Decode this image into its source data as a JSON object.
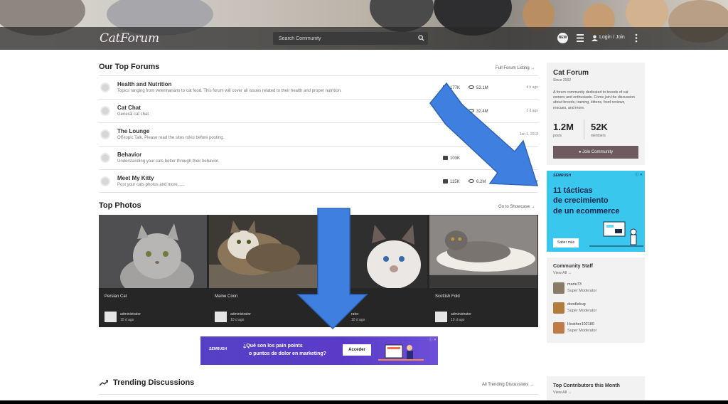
{
  "header": {
    "logo": "CatForum",
    "search_placeholder": "Search Community",
    "new_label": "NEW",
    "login_label": "Login / Join"
  },
  "top_forums": {
    "title": "Our Top Forums",
    "link": "Full Forum Listing →",
    "rows": [
      {
        "name": "Health and Nutrition",
        "desc": "Topics ranging from veterinarians to cat food. This forum will cover all issues related to their health and proper nutrition.",
        "threads": "177K",
        "views": "53.1M",
        "age": "4 h ago"
      },
      {
        "name": "Cat Chat",
        "desc": "General cat chat.",
        "threads": "K",
        "views": "32.4M",
        "age": "1 d ago"
      },
      {
        "name": "The Lounge",
        "desc": "Off-topic Talk. Please read the sites rules before posting.",
        "threads": "",
        "views": "",
        "age": "Jan 1, 2018"
      },
      {
        "name": "Behavior",
        "desc": "Understanding your cats better through their behavior.",
        "threads": "103K",
        "views": "",
        "age": ""
      },
      {
        "name": "Meet My Kitty",
        "desc": "Post your cats photos and more......",
        "threads": "115K",
        "views": "6.2M",
        "age": "ago"
      }
    ]
  },
  "top_photos": {
    "title": "Top Photos",
    "link": "Go to Showcase →",
    "cards": [
      {
        "name": "Persian Cat",
        "user": "administrator",
        "age": "10 d ago"
      },
      {
        "name": "Maine Coon",
        "user": "administrator",
        "age": "10 d ago"
      },
      {
        "name": "",
        "user": "rator",
        "age": "10 d ago"
      },
      {
        "name": "Scottish Fold",
        "user": "administrator",
        "age": "10 d ago"
      }
    ]
  },
  "ad_bottom": {
    "brand": "SEMRUSH",
    "line1": "¿Qué son los pain points",
    "line2": "o puntos de dolor en marketing?",
    "button": "Acceder",
    "close": "ⓘ ✕"
  },
  "trending": {
    "title": "Trending Discussions",
    "link": "All Trending Discussions →"
  },
  "sidebar": {
    "title": "Cat Forum",
    "since": "Since 2002",
    "description": "A forum community dedicated to breeds of cat owners and enthusiasts. Come join the discussion about breeds, training, kittens, food reviews, rescues, and more.",
    "posts_value": "1.2M",
    "posts_label": "posts",
    "members_value": "52K",
    "members_label": "members",
    "join_label": "Join Community"
  },
  "ad_side": {
    "brand": "SEMRUSH",
    "close": "ⓘ ✕",
    "line1": "11 tácticas",
    "line2": "de crecimiento",
    "line3": "de un ecommerce",
    "cta": "Saber más"
  },
  "staff": {
    "title": "Community Staff",
    "link": "View All →",
    "members": [
      {
        "name": "marie73",
        "role": "Super Moderator"
      },
      {
        "name": "doodlebug",
        "role": "Super Moderator"
      },
      {
        "name": "Heather102180",
        "role": "Super Moderator"
      }
    ]
  },
  "contributors": {
    "title": "Top Contributors this Month",
    "link": "View All →"
  },
  "colors": {
    "arrow_blue": "#3f7fe0",
    "join_button": "#6e5b5f",
    "ad_side_bg": "#39c7ee",
    "ad_bottom_bg": "#5640c6"
  }
}
